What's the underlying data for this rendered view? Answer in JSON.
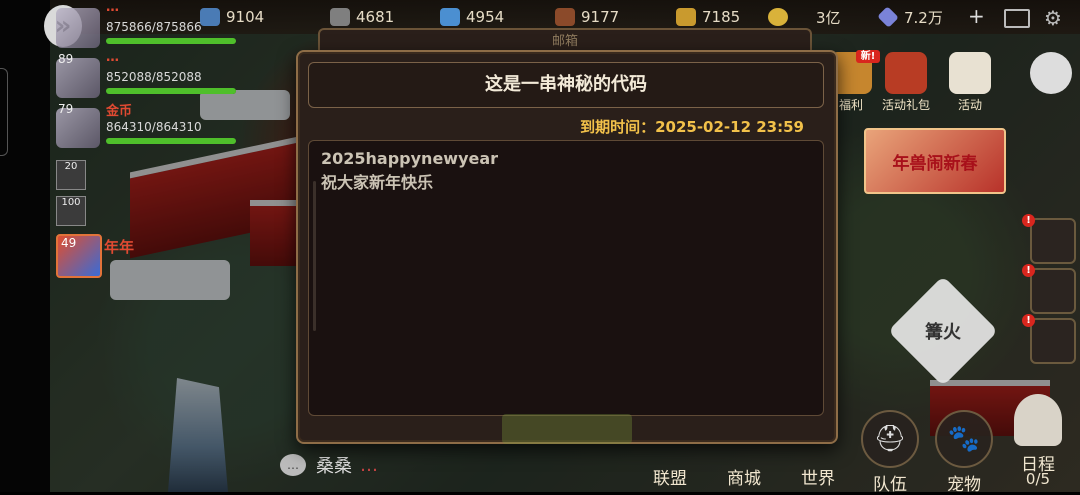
{
  "topbar": {
    "resources": [
      {
        "icon": "ore-icon",
        "value": "9104"
      },
      {
        "icon": "stone-icon",
        "value": "4681"
      },
      {
        "icon": "crystal-icon",
        "value": "4954"
      },
      {
        "icon": "wood-icon",
        "value": "9177"
      },
      {
        "icon": "wheat-icon",
        "value": "7185"
      },
      {
        "icon": "coin-icon",
        "value": "3亿"
      },
      {
        "icon": "diamond-icon",
        "value": "7.2万"
      }
    ],
    "plus": "+"
  },
  "party": {
    "collapse": "»",
    "members": [
      {
        "level": "",
        "name": "…",
        "hp": "875866/875866",
        "hp_fraction": 1.0
      },
      {
        "level": "89",
        "name": "…",
        "hp": "852088/852088",
        "hp_fraction": 1.0
      },
      {
        "level": "79",
        "name": "金币",
        "hp": "864310/864310",
        "hp_fraction": 1.0
      }
    ],
    "slots": [
      "20",
      "100"
    ],
    "pet": {
      "level": "49",
      "name": "年年"
    }
  },
  "right": {
    "events": [
      {
        "label": "福利",
        "icon": "welfare-icon"
      },
      {
        "label": "活动礼包",
        "icon": "gift-pack-icon"
      },
      {
        "label": "活动",
        "icon": "calendar-icon"
      }
    ],
    "banner": "年兽闹新春",
    "bonfire": "篝火",
    "new_badge": "新!"
  },
  "bottom_nav": [
    {
      "label": "联盟",
      "icon": ""
    },
    {
      "label": "商城",
      "icon": ""
    },
    {
      "label": "世界",
      "icon": ""
    },
    {
      "label": "队伍",
      "icon": "⛑"
    },
    {
      "label": "宠物",
      "icon": "🐾"
    }
  ],
  "schedule": {
    "label": "日程",
    "count": "0/5"
  },
  "chat": {
    "sender": "桑桑",
    "message": "…"
  },
  "modal": {
    "behind_title": "邮箱",
    "title": "这是一串神秘的代码",
    "expire_label": "到期时间：",
    "expire_time": "2025-02-12 23:59",
    "body_lines": [
      "2025happynewyear",
      "祝大家新年快乐"
    ]
  }
}
